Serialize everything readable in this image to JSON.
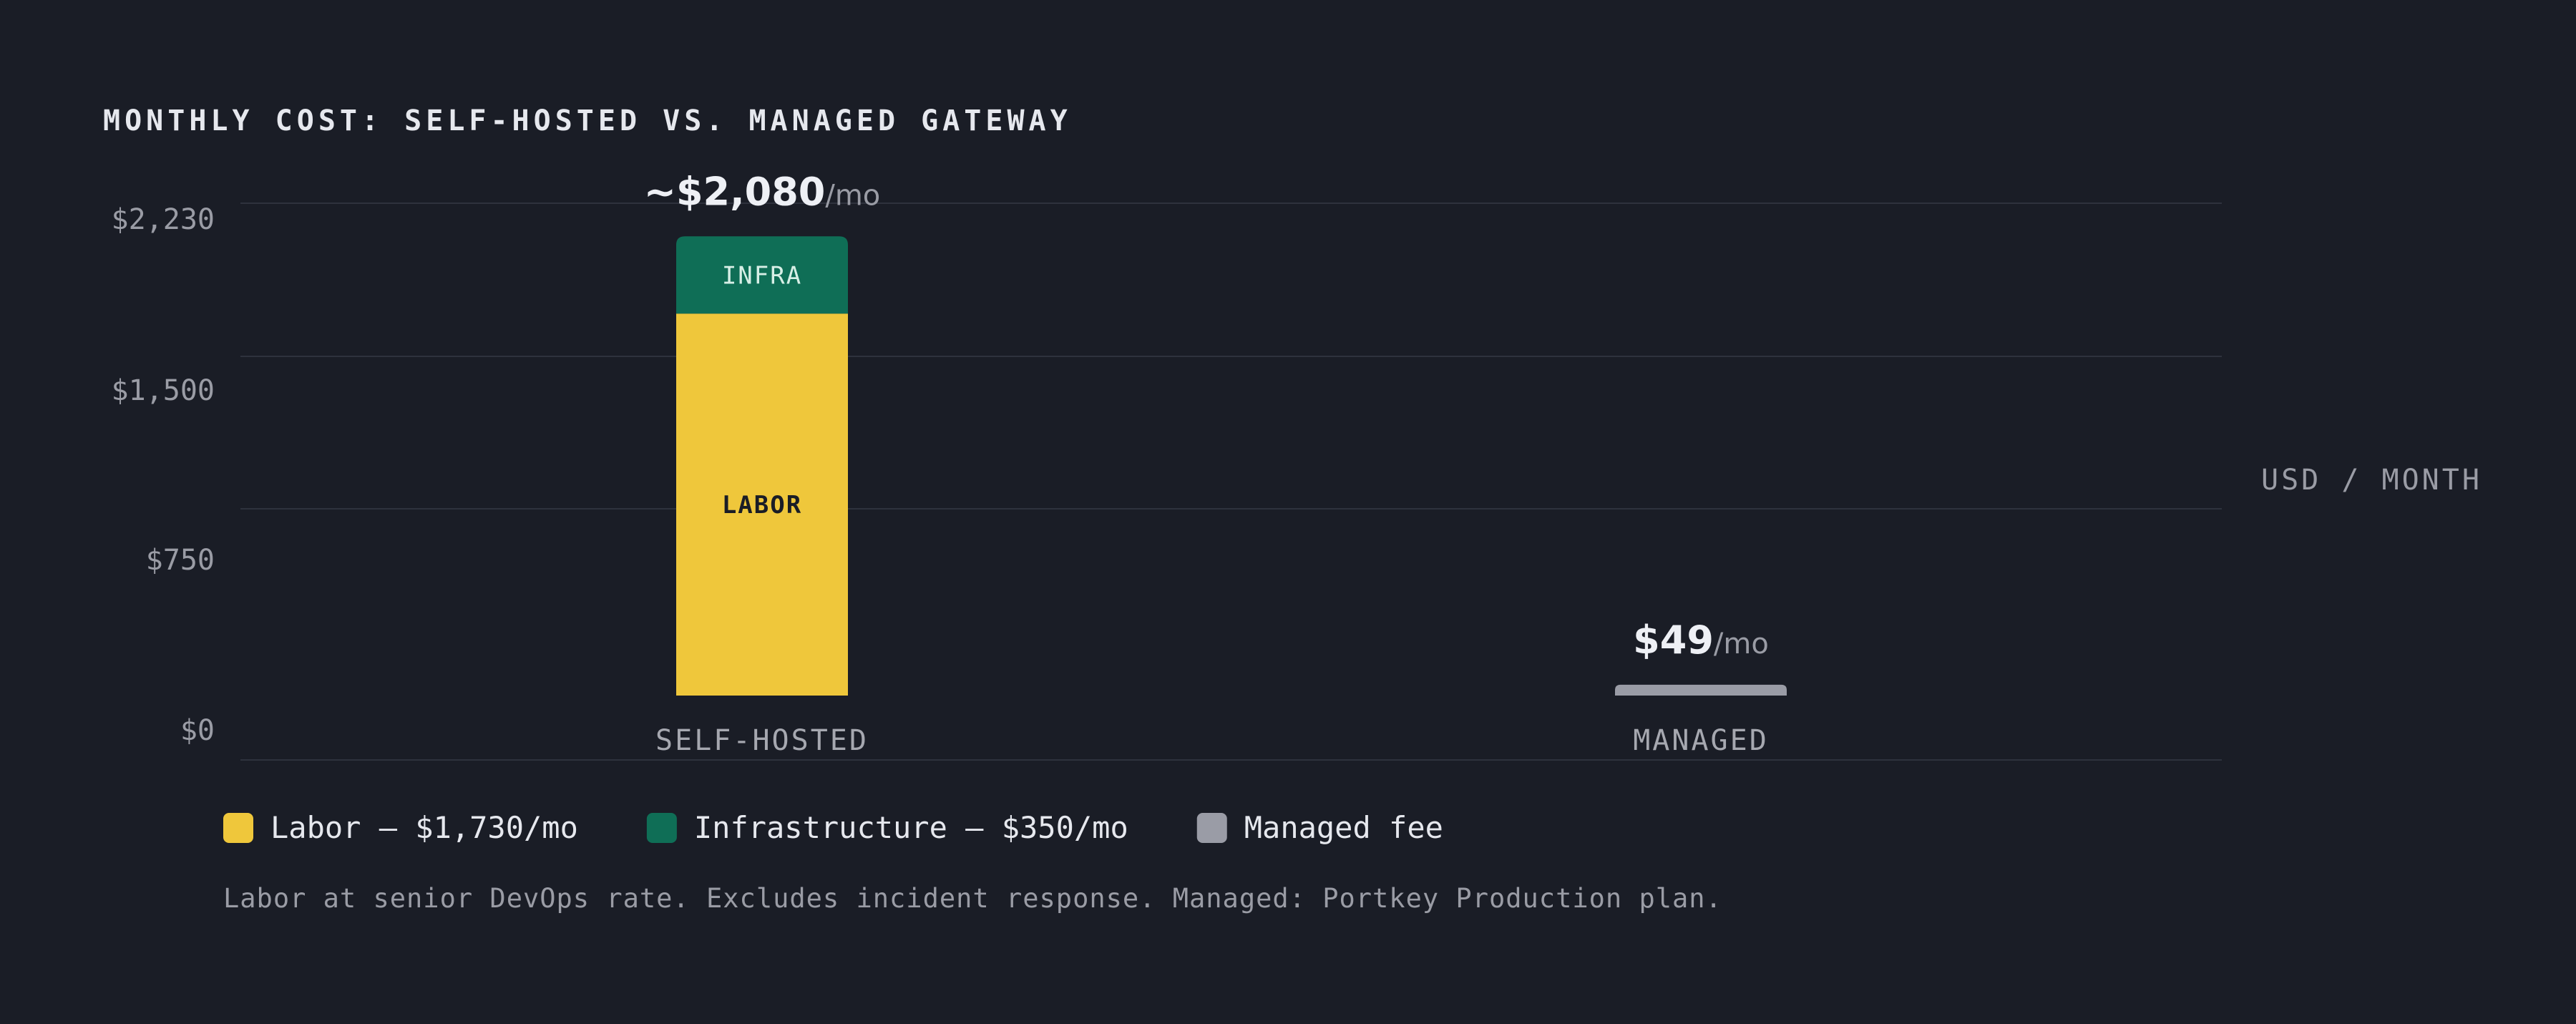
{
  "chart_data": {
    "type": "bar",
    "stacked": true,
    "title": "MONTHLY COST: SELF-HOSTED VS. MANAGED GATEWAY",
    "unit_label": "USD / MONTH",
    "categories": [
      "SELF-HOSTED",
      "MANAGED"
    ],
    "yticks": [
      "$0",
      "$750",
      "$1,500",
      "$2,230"
    ],
    "ylim": [
      0,
      2230
    ],
    "grid": true,
    "totals": [
      {
        "value": "~$2,080",
        "suffix": "/mo"
      },
      {
        "value": "$49",
        "suffix": "/mo"
      }
    ],
    "series": [
      {
        "name": "Labor",
        "values": [
          1730,
          0
        ],
        "color": "#efc73b",
        "segment_label": "LABOR",
        "label_color": "#1a1d26"
      },
      {
        "name": "Infrastructure",
        "values": [
          350,
          0
        ],
        "color": "#0f6e56",
        "segment_label": "INFRA",
        "label_color": "#d7efe6"
      },
      {
        "name": "Managed fee",
        "values": [
          0,
          49
        ],
        "color": "#9a9ca6",
        "segment_label": "",
        "label_color": "#1a1d26"
      }
    ],
    "legend": [
      {
        "text": "Labor — $1,730/mo",
        "color": "#efc73b"
      },
      {
        "text": "Infrastructure — $350/mo",
        "color": "#0f6e56"
      },
      {
        "text": "Managed fee",
        "color": "#9a9ca6"
      }
    ],
    "legend_position": "bottom-left",
    "footnote": "Labor at senior DevOps rate. Excludes incident response. Managed: Portkey Production plan."
  }
}
